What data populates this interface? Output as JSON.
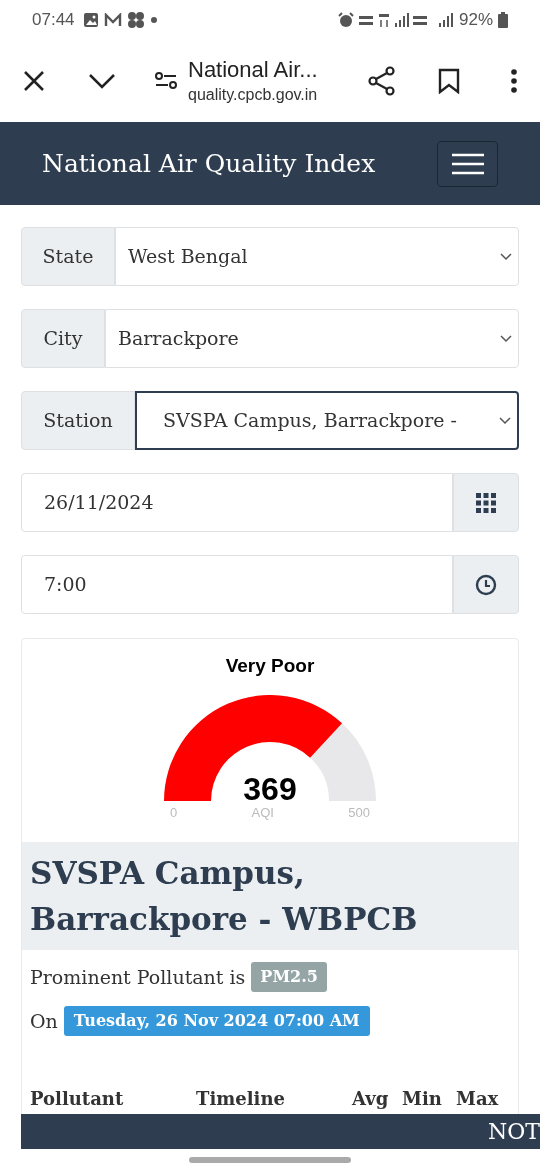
{
  "status_bar": {
    "time": "07:44",
    "battery": "92%"
  },
  "browser_bar": {
    "title": "National Air...",
    "url": "quality.cpcb.gov.in"
  },
  "navbar": {
    "title": "National Air Quality Index"
  },
  "selects": [
    {
      "label": "State",
      "value": "West Bengal",
      "focused": false
    },
    {
      "label": "City",
      "value": "Barrackpore",
      "focused": false
    },
    {
      "label": "Station",
      "value": "SVSPA Campus, Barrackpore -",
      "focused": true
    }
  ],
  "date_field": {
    "value": "26/11/2024"
  },
  "time_field": {
    "value": "7:00"
  },
  "gauge": {
    "category": "Very Poor",
    "value": "369",
    "min": "0",
    "unit": "AQI",
    "max": "500"
  },
  "station": {
    "name": "SVSPA Campus, Barrackpore - WBPCB",
    "prominent_label": "Prominent Pollutant is",
    "pollutant": "PM2.5",
    "on_label": "On",
    "datetime": "Tuesday, 26 Nov 2024 07:00 AM"
  },
  "table": {
    "columns": [
      "Pollutant",
      "Timeline",
      "Avg",
      "Min",
      "Max"
    ]
  },
  "note_bar": {
    "text": "NOT"
  }
}
